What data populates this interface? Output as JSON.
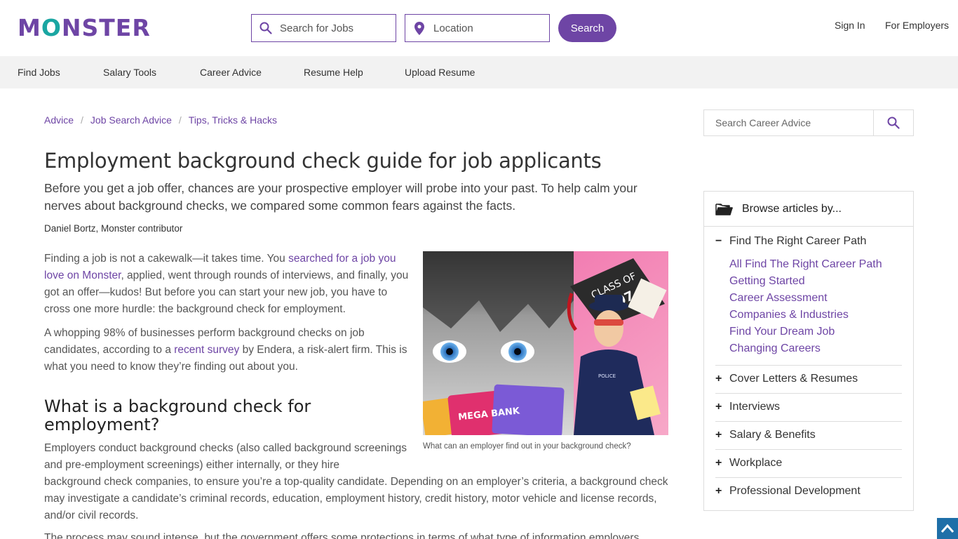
{
  "header": {
    "logo": {
      "pre": "M",
      "o": "O",
      "post": "NSTER"
    },
    "jobs_placeholder": "Search for Jobs",
    "location_placeholder": "Location",
    "search_button": "Search",
    "sign_in": "Sign In",
    "for_employers": "For Employers"
  },
  "nav": {
    "items": [
      "Find Jobs",
      "Salary Tools",
      "Career Advice",
      "Resume Help",
      "Upload Resume"
    ]
  },
  "breadcrumb": [
    "Advice",
    "Job Search Advice",
    "Tips, Tricks & Hacks"
  ],
  "article": {
    "title": "Employment background check guide for job applicants",
    "subtitle": "Before you get a job offer, chances are your prospective employer will probe into your past. To help calm your nerves about background checks, we compared some common fears against the facts.",
    "byline": "Daniel Bortz, Monster contributor",
    "p1_a": "Finding a job is not a cakewalk—it takes time. You ",
    "p1_link": "searched for a job you love on Monster",
    "p1_b": ", applied, went through rounds of interviews, and finally, you got an offer—kudos! But before you can start your new job, you have to cross one more hurdle: the background check for employment.",
    "p2_a": "A whopping 98% of businesses perform background checks on job candidates, according to a ",
    "p2_link": "recent survey",
    "p2_b": " by Endera, a risk-alert firm. This is what you need to know they’re finding out about you.",
    "h2": "What is a background check for employment?",
    "p3a": "Employers conduct background checks (also called background screenings and pre-employment screenings) either internally, or they hire",
    "p3b": "background check companies, to ensure you’re a top-quality candidate. Depending on an employer’s criteria, a background check may investigate a candidate’s criminal records, education, employment history, credit history, motor vehicle and license records, and/or civil records.",
    "p4": "The process may sound intense, but the government offers some protections in terms of what type of information employers",
    "image_caption": "What can an employer find out in your background check?",
    "image_text": {
      "cap": "CLASS OF",
      "year": "2007",
      "card": "MEGA BANK",
      "badge": "POLICE"
    }
  },
  "sidebar": {
    "search_placeholder": "Search Career Advice",
    "browse_title": "Browse articles by...",
    "expanded": {
      "label": "Find The Right Career Path",
      "items": [
        "All Find The Right Career Path",
        "Getting Started",
        "Career Assessment",
        "Companies & Industries",
        "Find Your Dream Job",
        "Changing Careers"
      ]
    },
    "categories": [
      "Cover Letters & Resumes",
      "Interviews",
      "Salary & Benefits",
      "Workplace",
      "Professional Development"
    ]
  },
  "colors": {
    "brand": "#6e45a5",
    "teal": "#1aa6a2",
    "nav_bg": "#f2f2f2",
    "to_top": "#1e6fa8"
  }
}
